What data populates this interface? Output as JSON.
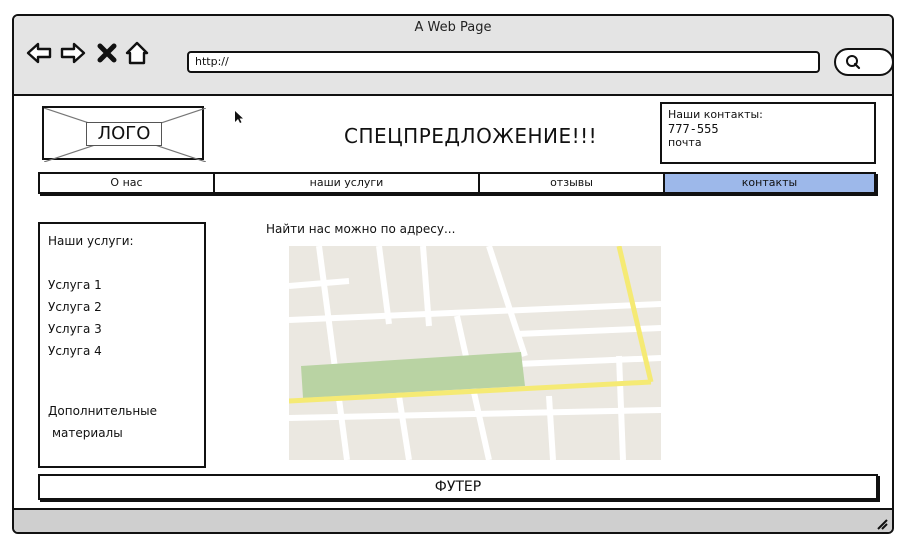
{
  "window": {
    "title": "A Web Page"
  },
  "toolbar": {
    "back_icon": "arrow-left-icon",
    "forward_icon": "arrow-right-icon",
    "stop_icon": "close-icon",
    "home_icon": "home-icon",
    "address": "http://",
    "search_icon": "search-icon"
  },
  "header": {
    "logo": "ЛОГО",
    "promo": "СПЕЦПРЕДЛОЖЕНИЕ!!!",
    "contacts": {
      "title": "Наши контакты:",
      "phone": "777-555",
      "mail": "почта"
    }
  },
  "nav": {
    "items": [
      {
        "label": "О нас"
      },
      {
        "label": "наши услуги"
      },
      {
        "label": "отзывы"
      },
      {
        "label": "контакты",
        "active": true
      }
    ],
    "active_color": "#9db8ea"
  },
  "sidebar": {
    "title": "Наши услуги:",
    "services": [
      "Услуга 1",
      "Услуга 2",
      "Услуга 3",
      "Услуга 4"
    ],
    "extra_line1": "Дополнительные",
    "extra_line2": "материалы"
  },
  "main": {
    "find_text": "Найти нас можно по адресу..."
  },
  "footer": {
    "label": "ФУТЕР"
  },
  "colors": {
    "map_bg": "#ebe8e1",
    "map_road": "#ffffff",
    "map_main_road": "#f5ea74",
    "map_park": "#b9d3a3"
  }
}
